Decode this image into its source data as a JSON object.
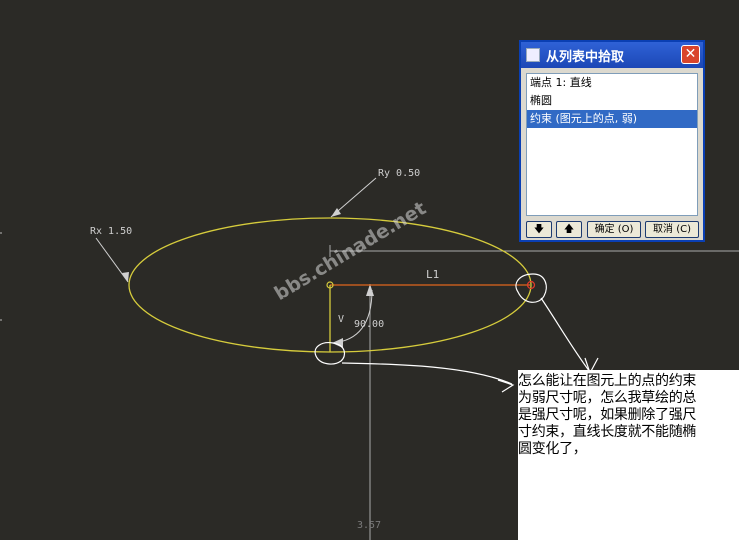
{
  "canvas": {
    "labels": {
      "rx": "Rx 1.50",
      "ry": "Ry 0.50",
      "length": "L1",
      "v_label": "V",
      "angle": "90.00",
      "bottom_dim": "3.57"
    },
    "watermark": "bbs.chinade.net",
    "colors": {
      "background": "#2b2a26",
      "ellipse": "#d6cc3c",
      "line": "#e0661e",
      "dim": "#d0d0d0"
    }
  },
  "dialog": {
    "title": "从列表中拾取",
    "items": [
      "端点 1: 直线",
      "椭圆",
      "约束 (图元上的点, 弱)"
    ],
    "selected_index": 2,
    "buttons": {
      "down": "🡇",
      "up": "🡅",
      "ok": "确定 (O)",
      "cancel": "取消 (C)"
    },
    "close": "✕"
  },
  "note": {
    "lines": [
      "怎么能让在图元上的点的约束",
      "为弱尺寸呢，怎么我草绘的总",
      "是强尺寸呢，如果删除了强尺",
      "寸约束，直线长度就不能随椭",
      "圆变化了，"
    ]
  }
}
